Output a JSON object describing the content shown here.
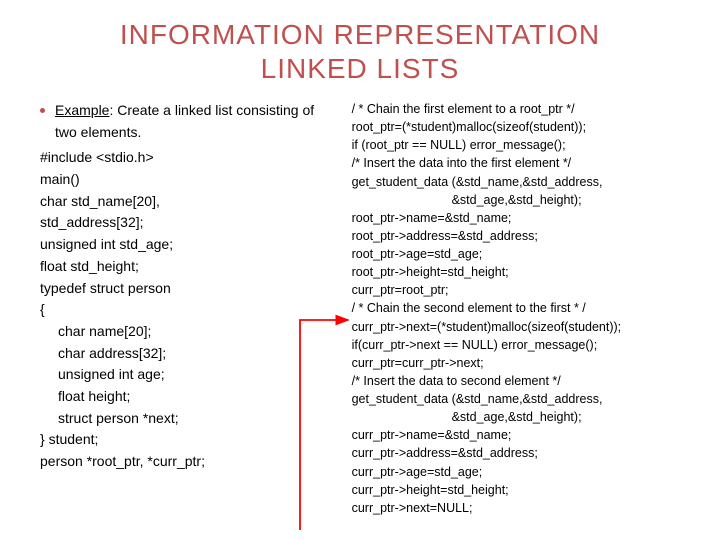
{
  "title_line1": "INFORMATION REPRESENTATION",
  "title_line2": "LINKED LISTS",
  "left": {
    "bullet_prefix": "Example",
    "bullet_rest": ": Create a linked list consisting of two elements.",
    "lines": [
      "#include <stdio.h>",
      "main()",
      "char std_name[20],",
      "std_address[32];",
      "unsigned int std_age;",
      "float std_height;",
      "typedef struct person",
      "{"
    ],
    "inner": [
      "char name[20];",
      "char address[32];",
      "unsigned int age;",
      "float height;",
      "struct person *next;"
    ],
    "after": [
      "} student;",
      "person *root_ptr, *curr_ptr;"
    ]
  },
  "right": {
    "lines_a": [
      "/ * Chain the first element to a root_ptr */",
      "root_ptr=(*student)malloc(sizeof(student));",
      "if (root_ptr == NULL) error_message();",
      "/* Insert the data into the first element */",
      "get_student_data (&std_name,&std_address,"
    ],
    "indent_a": "&std_age,&std_height);",
    "lines_b": [
      "root_ptr->name=&std_name;",
      "root_ptr->address=&std_address;",
      "root_ptr->age=std_age;",
      "root_ptr->height=std_height;",
      "curr_ptr=root_ptr;",
      "/ * Chain the second element to the first * /",
      "curr_ptr->next=(*student)malloc(sizeof(student));",
      "if(curr_ptr->next == NULL) error_message();",
      "curr_ptr=curr_ptr->next;",
      "/* Insert the data to second element */",
      "get_student_data (&std_name,&std_address,"
    ],
    "indent_b": "&std_age,&std_height);",
    "lines_c": [
      "curr_ptr->name=&std_name;",
      "curr_ptr->address=&std_address;",
      "curr_ptr->age=std_age;",
      "curr_ptr->height=std_height;",
      "curr_ptr->next=NULL;"
    ]
  }
}
